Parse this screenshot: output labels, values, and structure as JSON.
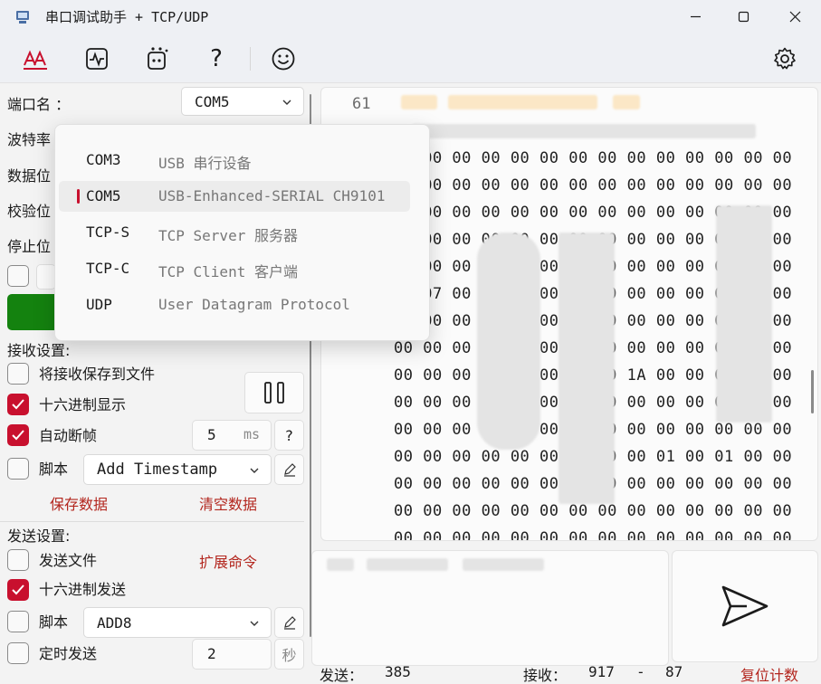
{
  "window": {
    "title": "串口调试助手 + TCP/UDP"
  },
  "toolbar": {
    "icons": [
      "font-icon",
      "waveform-icon",
      "plugin-icon",
      "help-icon",
      "smiley-icon",
      "settings-icon"
    ],
    "help_glyph": "?"
  },
  "left": {
    "port_label": "端口名 ：",
    "port_value": "COM5",
    "baud_label": "波特率",
    "data_bits_label": "数据位",
    "parity_label": "校验位",
    "stop_bits_label": "停止位",
    "recv_section": "接收设置:",
    "save_to_file": "将接收保存到文件",
    "hex_display": "十六进制显示",
    "auto_frame": "自动断帧",
    "auto_frame_value": "5",
    "auto_frame_unit": "ms",
    "help_q": "?",
    "recv_script": "脚本",
    "recv_script_value": "Add Timestamp",
    "save_data": "保存数据",
    "clear_data": "清空数据",
    "send_section": "发送设置:",
    "send_file": "发送文件",
    "extend_cmd": "扩展命令",
    "hex_send": "十六进制发送",
    "send_script": "脚本",
    "send_script_value": "ADD8",
    "timed_send": "定时发送",
    "timed_value": "2",
    "timed_unit": "秒",
    "pause_glyph": "▯▯",
    "checkbox_states": {
      "save_to_file": false,
      "hex_display": true,
      "auto_frame": true,
      "recv_script": false,
      "send_file": false,
      "hex_send": true,
      "send_script": false,
      "timed_send": false,
      "rts": false
    }
  },
  "receive": {
    "line_number": "61",
    "rows": [
      "00 00 00 00 00 00 00 00 00 00 00 00 00 00",
      "00 00 00 00 00 00 00 00 00 00 00 00 00 00",
      "00 00 00 00 00 00 00 00 00 00 00 00 00 00",
      "00 00 00 00 00 00 00 00 00 00 00 00 00 00",
      "00 00 00 00 00 00 00 00 00 00 00 00 00 00",
      "00 07 00 00 00 00 00 00 00 00 00 00 00 00",
      "00 00 00 00 00 00 00 00 00 00 00 00 00 00",
      "00 00 00 00 00 00 00 00 00 00 00 00 00 00",
      "00 00 00 00 00 00 00 00 1A 00 00 00 00 00",
      "00 00 00 00 00 00 00 00 00 00 00 00 00 00",
      "00 00 00 00 00 00 00 00 00 00 00 00 00 00",
      "00 00 00 00 00 00 00 00 00 01 00 01 00 00",
      "00 00 00 00 00 00 00 00 00 00 00 00 00 00",
      "00 00 00 00 00 00 00 00 00 00 00 00 00 00",
      "00 00 00 00 00 00 00 00 00 00 00 00 00 00"
    ]
  },
  "status": {
    "sent_label": "发送：",
    "sent_value": "385",
    "recv_label": "接收：",
    "recv_value": "917",
    "sep": "-",
    "recv_value2": "87",
    "reset": "复位计数"
  },
  "dropdown": {
    "items": [
      {
        "name": "COM3",
        "desc": "USB 串行设备",
        "selected": false
      },
      {
        "name": "COM5",
        "desc": "USB-Enhanced-SERIAL CH9101",
        "selected": true
      },
      {
        "name": "TCP-S",
        "desc": "TCP Server 服务器",
        "selected": false
      },
      {
        "name": "TCP-C",
        "desc": "TCP Client 客户端",
        "selected": false
      },
      {
        "name": "UDP",
        "desc": "User Datagram Protocol",
        "selected": false
      }
    ]
  },
  "colors": {
    "accent": "#c8102e",
    "connect_green": "#14820f",
    "link_red": "#b3261e"
  }
}
